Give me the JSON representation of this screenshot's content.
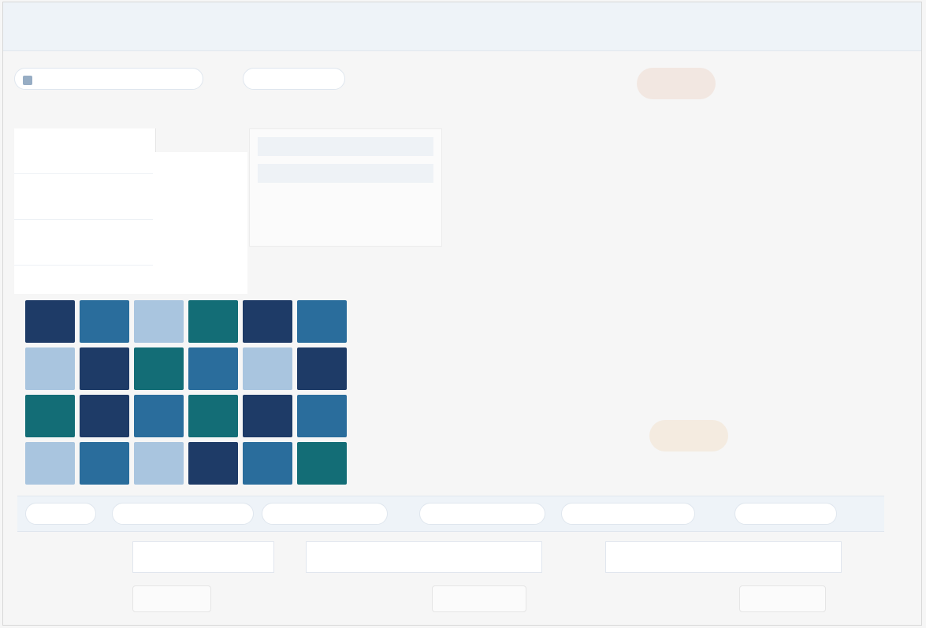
{
  "window": {
    "title": ""
  },
  "toolbar": [
    {
      "label": ""
    },
    {
      "label": ""
    },
    {
      "label": ""
    }
  ],
  "left_panel": {
    "items": [
      "",
      "",
      ""
    ]
  },
  "panel": {
    "caption": ""
  },
  "grid": {
    "cells": [
      "",
      "",
      "",
      "",
      "",
      "",
      "",
      "",
      "",
      "",
      "",
      "",
      "",
      "",
      "",
      "",
      "",
      "",
      "",
      "",
      "",
      "",
      "",
      ""
    ]
  },
  "bottom_bar": {
    "items": [
      "",
      "",
      "",
      "",
      "",
      ""
    ]
  },
  "inputs": [
    {
      "value": "",
      "placeholder": ""
    },
    {
      "value": "",
      "placeholder": ""
    },
    {
      "value": "",
      "placeholder": ""
    }
  ],
  "status": {
    "left": "",
    "center": "",
    "right": ""
  },
  "buttons": {
    "float_top": "",
    "float_mid": ""
  }
}
